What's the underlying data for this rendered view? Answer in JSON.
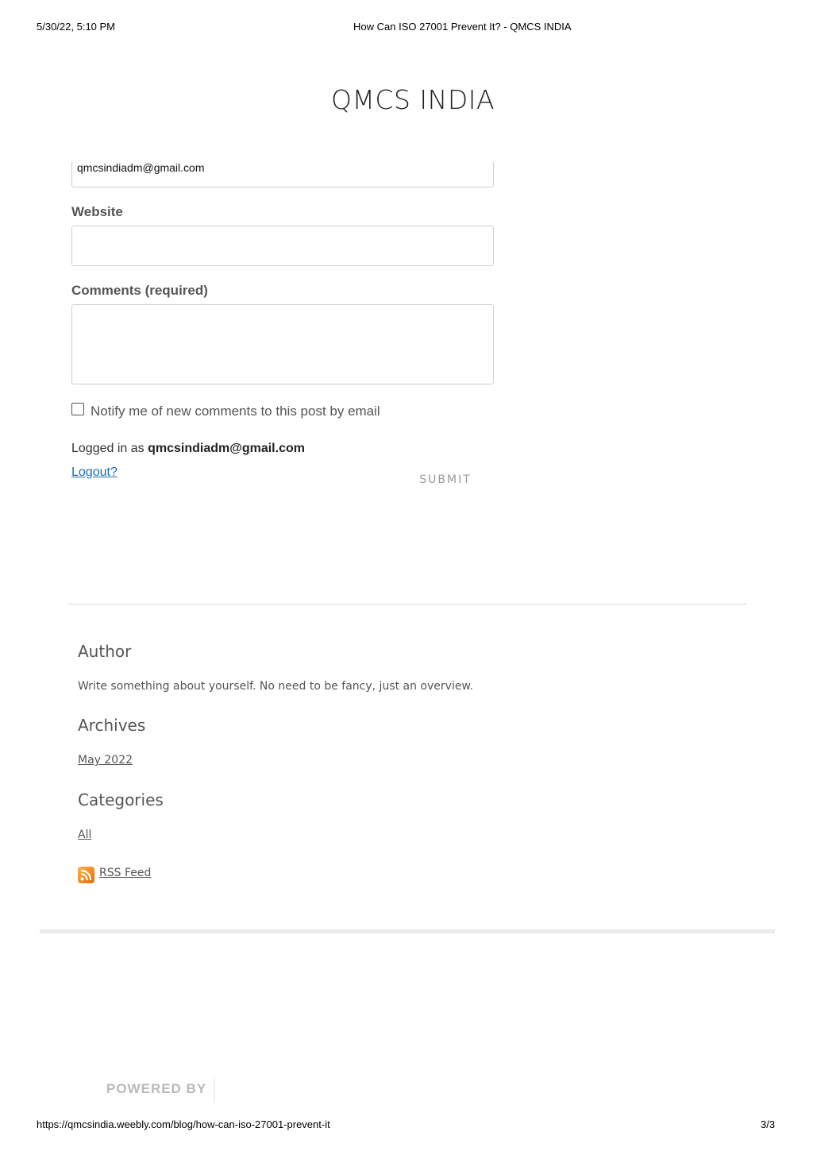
{
  "print_header": {
    "datetime": "5/30/22, 5:10 PM",
    "page_title": "How Can ISO 27001 Prevent It? - QMCS INDIA"
  },
  "site": {
    "title": "QMCS INDIA"
  },
  "comment_form": {
    "email_value": "qmcsindiadm@gmail.com",
    "website_label": "Website",
    "website_value": "",
    "comments_label": "Comments (required)",
    "comments_value": "",
    "notify_label": "Notify me of new comments to this post by email",
    "notify_checked": false,
    "logged_in_prefix": "Logged in as",
    "logged_in_user": "qmcsindiadm@gmail.com",
    "logout_label": "Logout?",
    "submit_label": "SUBMIT"
  },
  "sidebar": {
    "author_heading": "Author",
    "author_text": "Write something about yourself. No need to be fancy, just an overview.",
    "archives_heading": "Archives",
    "archives": [
      "May 2022"
    ],
    "categories_heading": "Categories",
    "categories": [
      "All"
    ],
    "rss_label": "RSS Feed",
    "rss_icon": "rss-icon"
  },
  "footer": {
    "powered_by": "POWERED BY"
  },
  "print_footer": {
    "url": "https://qmcsindia.weebly.com/blog/how-can-iso-27001-prevent-it",
    "page_number": "3/3"
  }
}
